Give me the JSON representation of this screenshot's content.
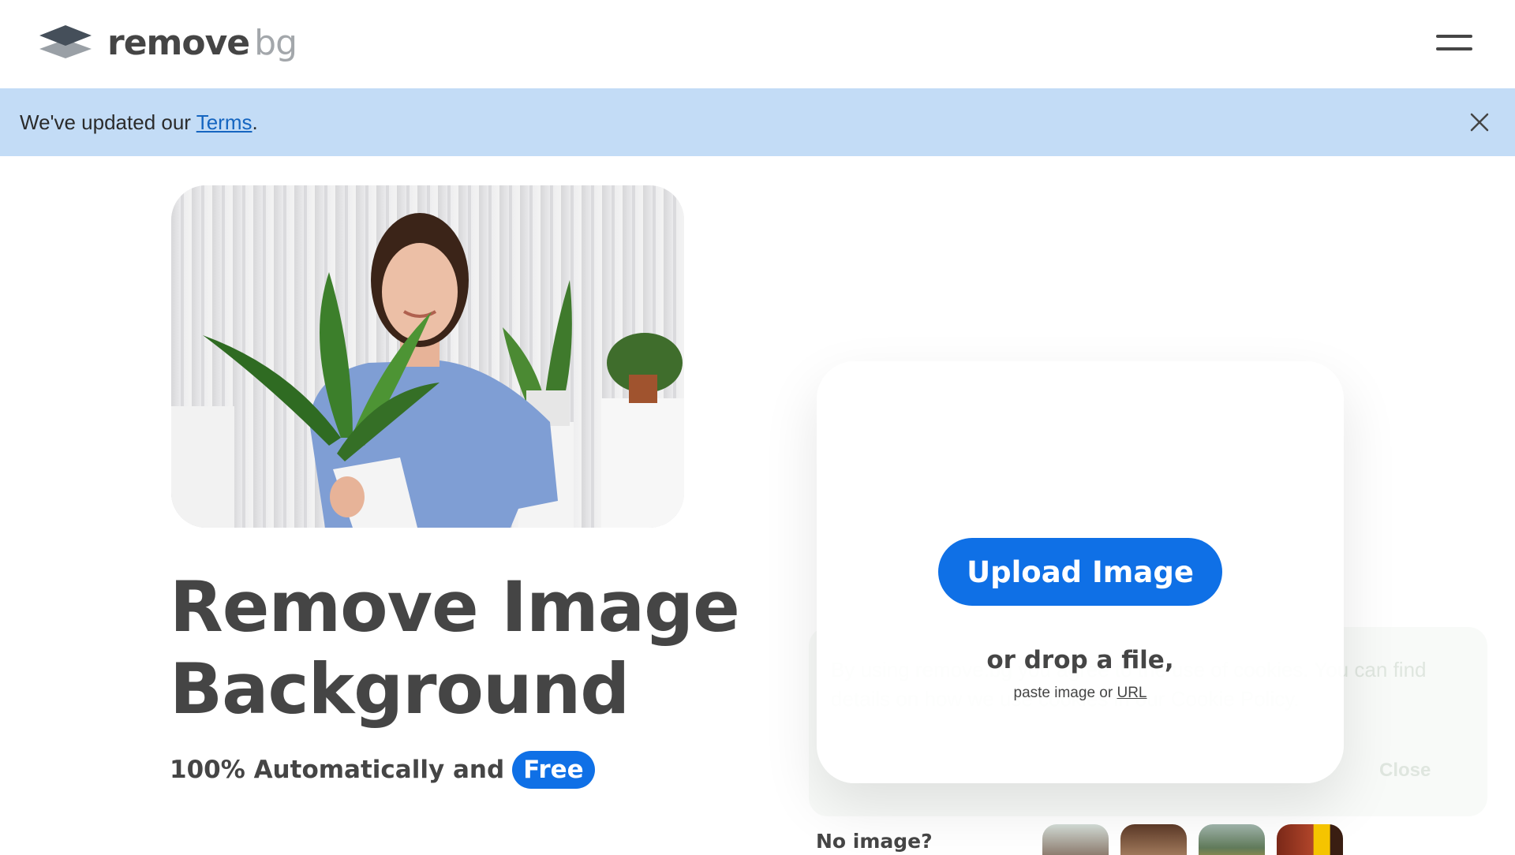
{
  "header": {
    "logo_word_primary": "remove",
    "logo_word_secondary": "bg",
    "menu_icon": "hamburger-menu-icon"
  },
  "banner": {
    "text_before": "We've updated our ",
    "link_label": "Terms",
    "text_after": ".",
    "close_icon": "close-icon",
    "background_color": "#c3dcf6"
  },
  "hero": {
    "headline_line1": "Remove Image",
    "headline_line2": "Background",
    "tagline": "100% Automatically and",
    "badge": "Free"
  },
  "upload": {
    "button_label": "Upload Image",
    "drop_text": "or drop a file,",
    "paste_text": "paste image or ",
    "url_link": "URL"
  },
  "cookie": {
    "text": "By using remove.bg you agree to the use of cookies. You can find details on how we use cookies in our Cookie Policy.",
    "close_label": "Close"
  },
  "samples": {
    "label": "No image?"
  },
  "colors": {
    "accent": "#0f70e6",
    "text": "#454545"
  }
}
